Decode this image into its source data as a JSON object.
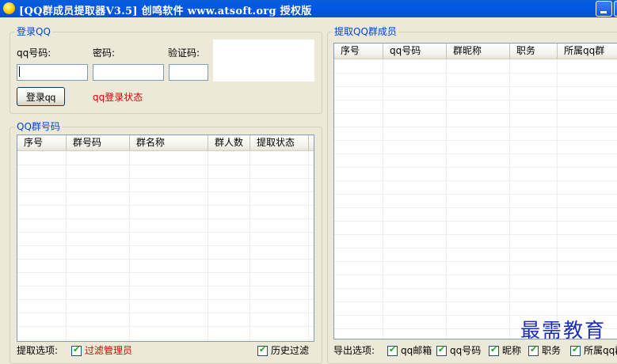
{
  "window": {
    "title": "[QQ群成员提取器V3.5] 创鸣软件 www.atsoft.org 授权版"
  },
  "login": {
    "group_title": "登录QQ",
    "qq_label": "qq号码:",
    "password_label": "密码:",
    "captcha_label": "验证码:",
    "qq_value": "",
    "password_value": "",
    "captcha_value": "",
    "login_button": "登录qq",
    "status": "qq登录状态"
  },
  "groups": {
    "group_title": "QQ群号码",
    "columns": [
      "序号",
      "群号码",
      "群名称",
      "群人数",
      "提取状态"
    ],
    "rows": []
  },
  "extract_options": {
    "label": "提取选项:",
    "filter_admin": {
      "label": "过滤管理员",
      "checked": true
    },
    "history_filter": {
      "label": "历史过滤",
      "checked": true
    }
  },
  "members": {
    "group_title": "提取QQ群成员",
    "columns": [
      "序号",
      "qq号码",
      "群昵称",
      "职务",
      "所属qq群"
    ],
    "rows": []
  },
  "export_options": {
    "label": "导出选项:",
    "items": [
      {
        "label": "qq邮箱",
        "checked": true
      },
      {
        "label": "qq号码",
        "checked": true
      },
      {
        "label": "昵称",
        "checked": true
      },
      {
        "label": "职务",
        "checked": true
      },
      {
        "label": "所属qq群",
        "checked": true
      }
    ]
  },
  "watermark": "最需教育"
}
